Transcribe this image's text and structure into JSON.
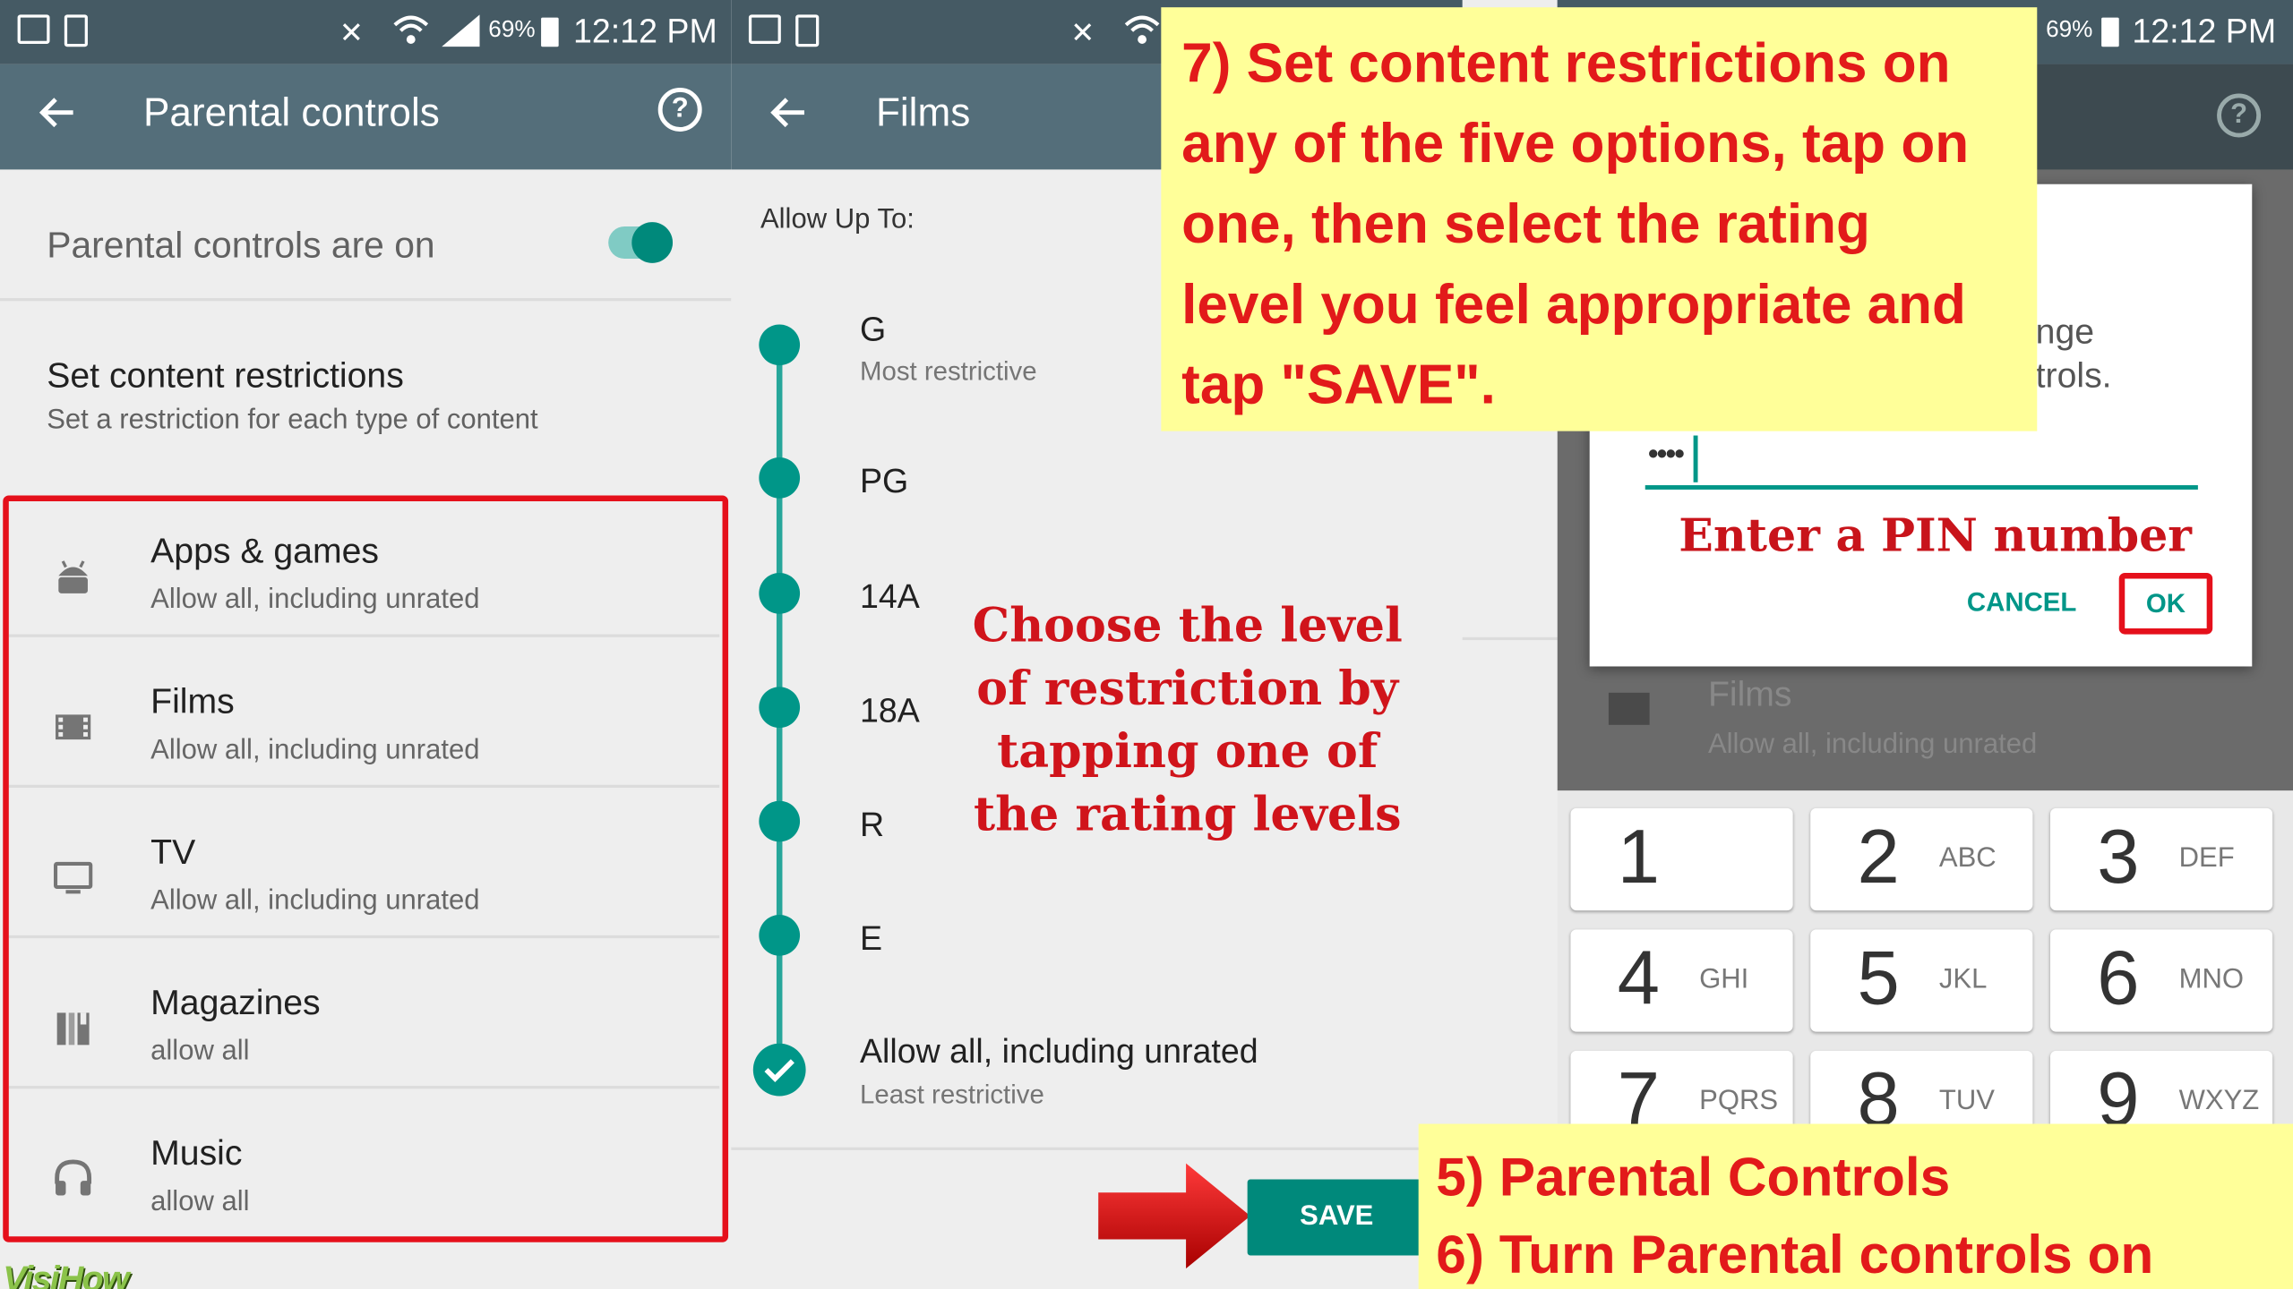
{
  "status": {
    "battery": "69%",
    "time": "12:12 PM"
  },
  "panel1": {
    "title": "Parental controls",
    "toggle_label": "Parental controls are on",
    "content_title": "Set content restrictions",
    "content_sub": "Set a restriction for each type of content",
    "items": [
      {
        "name": "Apps & games",
        "desc": "Allow all, including unrated",
        "icon": "android-icon"
      },
      {
        "name": "Films",
        "desc": "Allow all, including unrated",
        "icon": "film-icon"
      },
      {
        "name": "TV",
        "desc": "Allow all, including unrated",
        "icon": "tv-icon"
      },
      {
        "name": "Magazines",
        "desc": "allow all",
        "icon": "book-icon"
      },
      {
        "name": "Music",
        "desc": "allow all",
        "icon": "headphones-icon"
      }
    ]
  },
  "panel2": {
    "title": "Films",
    "allow_up_to": "Allow Up To:",
    "ratings": [
      {
        "label": "G",
        "sub": "Most restrictive"
      },
      {
        "label": "PG",
        "sub": ""
      },
      {
        "label": "14A",
        "sub": ""
      },
      {
        "label": "18A",
        "sub": ""
      },
      {
        "label": "R",
        "sub": ""
      },
      {
        "label": "E",
        "sub": ""
      },
      {
        "label": "Allow all, including unrated",
        "sub": "Least restrictive"
      }
    ],
    "selected_rating": "Allow all, including unrated",
    "save_label": "SAVE",
    "overlay_lines": [
      "Choose the level",
      "of restriction by",
      "tapping one of",
      "the rating levels"
    ]
  },
  "panel3": {
    "dialog_text_lines": [
      "nge",
      "trols."
    ],
    "pin_value": "••••",
    "pin_annotation": "Enter a PIN number",
    "cancel_label": "CANCEL",
    "ok_label": "OK",
    "bg_item_name": "Films",
    "bg_item_desc": "Allow all, including unrated",
    "keys": [
      {
        "num": "1",
        "letters": ""
      },
      {
        "num": "2",
        "letters": "ABC"
      },
      {
        "num": "3",
        "letters": "DEF"
      },
      {
        "num": "4",
        "letters": "GHI"
      },
      {
        "num": "5",
        "letters": "JKL"
      },
      {
        "num": "6",
        "letters": "MNO"
      },
      {
        "num": "7",
        "letters": "PQRS"
      },
      {
        "num": "8",
        "letters": "TUV"
      },
      {
        "num": "9",
        "letters": "WXYZ"
      }
    ]
  },
  "callouts": {
    "step7_lines": [
      "7) Set content restrictions on",
      "any of the five options, tap on",
      "one, then select the rating",
      "level you feel appropriate and",
      "tap \"SAVE\"."
    ],
    "step5": "5) Parental Controls",
    "step6": "6) Turn Parental controls on"
  },
  "watermark": "VisiHow",
  "colors": {
    "teal": "#009688",
    "status_bar": "#455a64",
    "app_bar": "#546e7a",
    "highlight_red": "#e5101b",
    "callout_yellow": "#ffff99"
  }
}
